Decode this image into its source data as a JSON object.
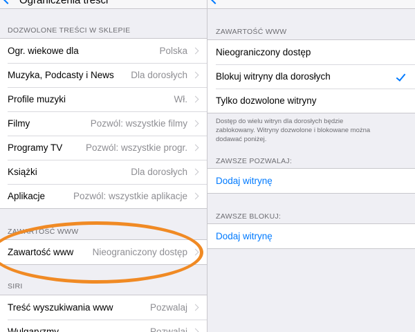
{
  "left": {
    "nav_title": "Ograniczenia treści",
    "sections": {
      "store": {
        "header": "DOZWOLONE TREŚCI W SKLEPIE",
        "rows": [
          {
            "label": "Ogr. wiekowe dla",
            "value": "Polska"
          },
          {
            "label": "Muzyka, Podcasty i News",
            "value": "Dla dorosłych"
          },
          {
            "label": "Profile muzyki",
            "value": "Wł."
          },
          {
            "label": "Filmy",
            "value": "Pozwól: wszystkie filmy"
          },
          {
            "label": "Programy TV",
            "value": "Pozwól: wszystkie progr."
          },
          {
            "label": "Książki",
            "value": "Dla dorosłych"
          },
          {
            "label": "Aplikacje",
            "value": "Pozwól: wszystkie aplikacje"
          }
        ]
      },
      "web": {
        "header": "ZAWARTOŚĆ WWW",
        "rows": [
          {
            "label": "Zawartość www",
            "value": "Nieograniczony dostęp"
          }
        ]
      },
      "siri": {
        "header": "SIRI",
        "rows": [
          {
            "label": "Treść wyszukiwania www",
            "value": "Pozwalaj"
          },
          {
            "label": "Wulgaryzmy",
            "value": "Pozwalaj"
          }
        ]
      }
    }
  },
  "right": {
    "web_content": {
      "header": "ZAWARTOŚĆ WWW",
      "options": [
        {
          "label": "Nieograniczony dostęp",
          "selected": false
        },
        {
          "label": "Blokuj witryny dla dorosłych",
          "selected": true
        },
        {
          "label": "Tylko dozwolone witryny",
          "selected": false
        }
      ],
      "footer": "Dostęp do wielu witryn dla dorosłych będzie zablokowany. Witryny dozwolone i blokowane można dodawać poniżej."
    },
    "always_allow": {
      "header": "ZAWSZE POZWALAJ:",
      "add_label": "Dodaj witrynę"
    },
    "always_block": {
      "header": "ZAWSZE BLOKUJ:",
      "add_label": "Dodaj witrynę"
    }
  },
  "colors": {
    "accent": "#007aff",
    "annotation": "#f08a24",
    "background": "#efeff4"
  },
  "icons": {
    "back": "chevron-left-icon",
    "disclosure": "chevron-right-icon",
    "selected": "checkmark-icon"
  }
}
